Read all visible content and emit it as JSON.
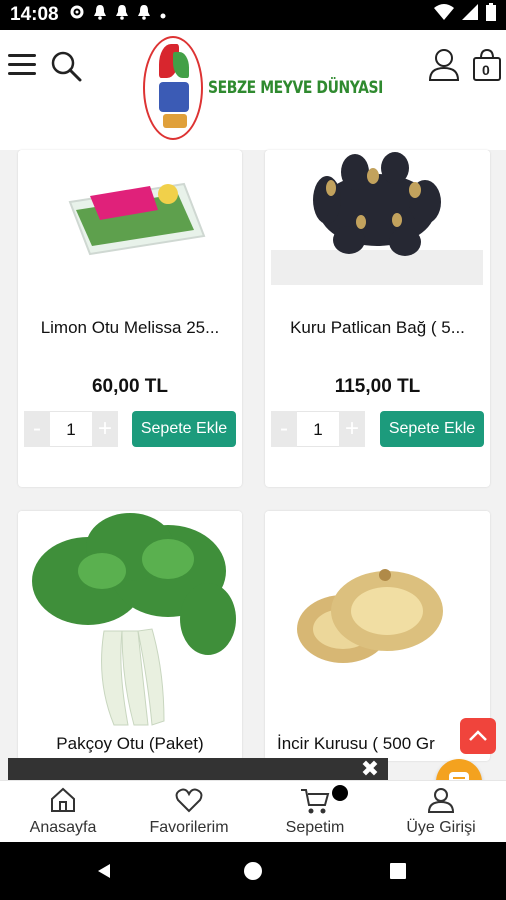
{
  "status_bar": {
    "time": "14:08"
  },
  "header": {
    "brand_name": "SEBZE MEYVE DÜNYASI",
    "cart_count": "0"
  },
  "products": [
    {
      "name": "Limon Otu Melissa 25...",
      "price": "60,00 TL",
      "qty": "1",
      "add_label": "Sepete Ekle"
    },
    {
      "name": "Kuru Patlican Bağ ( 5...",
      "price": "115,00 TL",
      "qty": "1",
      "add_label": "Sepete Ekle"
    },
    {
      "name": "Pakçoy Otu (Paket)"
    },
    {
      "name": "İncir Kurusu ( 500 Gr"
    }
  ],
  "qty_controls": {
    "minus": "-",
    "plus": "+"
  },
  "banner": {
    "close": "✖"
  },
  "bottom_nav": [
    {
      "label": "Anasayfa"
    },
    {
      "label": "Favorilerim"
    },
    {
      "label": "Sepetim"
    },
    {
      "label": "Üye Girişi"
    }
  ],
  "colors": {
    "accent": "#1c9b7c",
    "brand": "#2f8a2f",
    "scroll_top": "#f0443c",
    "chat": "#f4a21f"
  }
}
